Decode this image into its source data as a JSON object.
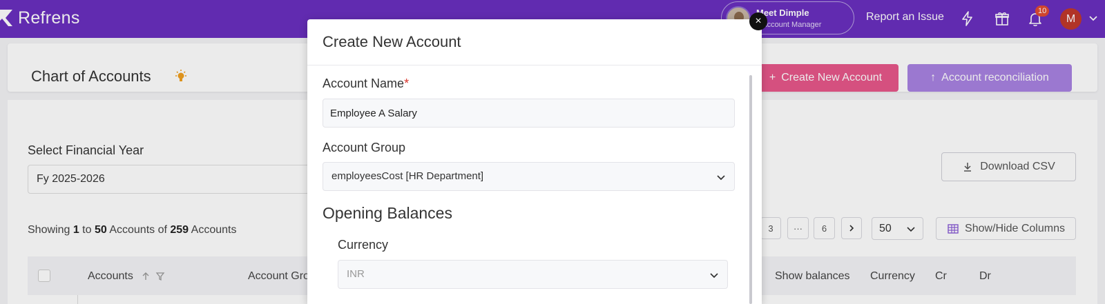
{
  "app": {
    "logo_text": "Refrens",
    "manager_name": "Meet Dimple",
    "manager_role": "ur Account Manager",
    "report_label": "Report an Issue",
    "notification_count": "10",
    "user_initial": "M"
  },
  "page": {
    "title": "Chart of Accounts",
    "create_button": "Create New Account",
    "reconciliation_button": "Account reconciliation",
    "fy_label": "Select Financial Year",
    "fy_value": "Fy 2025-2026",
    "download_csv": "Download CSV",
    "showing": {
      "prefix": "Showing ",
      "from": "1",
      "to_word": " to ",
      "to": "50",
      "accounts_of": " Accounts of ",
      "total": "259",
      "suffix": " Accounts"
    },
    "pagination": [
      "3",
      "···",
      "6"
    ],
    "per_page": "50",
    "show_hide_columns": "Show/Hide Columns",
    "table_headers": {
      "accounts": "Accounts",
      "account_group": "Account Gro",
      "show_balances": "Show balances",
      "currency": "Currency",
      "cr": "Cr",
      "dr": "Dr"
    }
  },
  "modal": {
    "title": "Create New Account",
    "account_name_label": "Account Name",
    "required_mark": "*",
    "account_name_value": "Employee A Salary",
    "account_group_label": "Account Group",
    "account_group_value": "employeesCost [HR Department]",
    "opening_balances_title": "Opening Balances",
    "currency_label": "Currency",
    "currency_value": "INR",
    "close_symbol": "×"
  },
  "colors": {
    "topbar": "#6a2fbf",
    "create_button": "#e8578a",
    "reconciliation_button": "#a983e2",
    "notification_badge": "#e14b32",
    "user_avatar": "#c0392b"
  }
}
